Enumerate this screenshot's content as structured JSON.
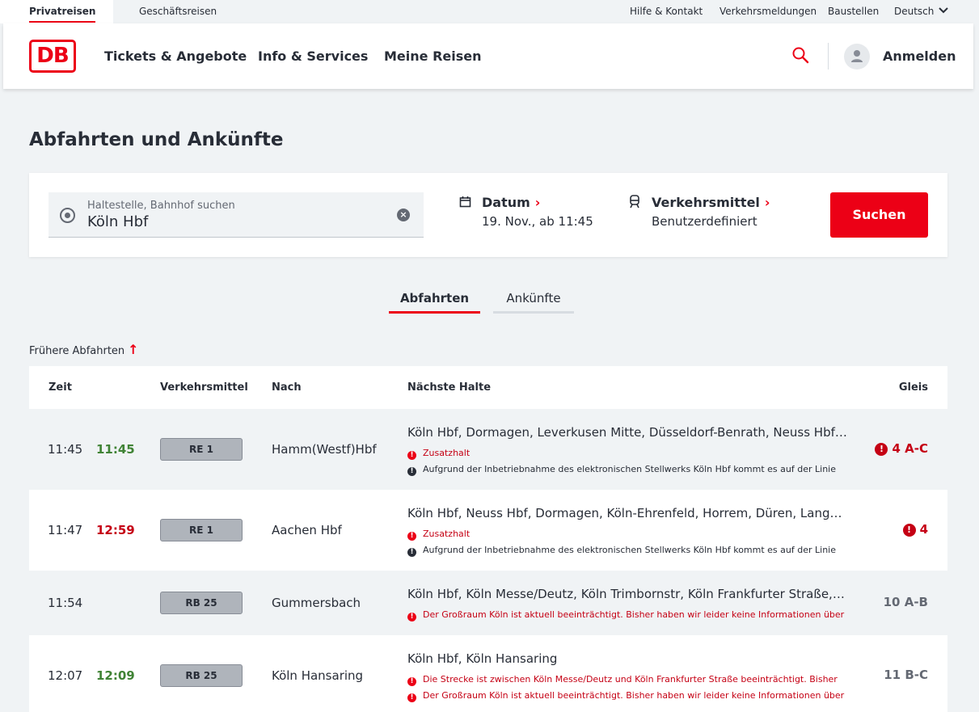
{
  "topbar": {
    "tab_private": "Privatreisen",
    "tab_business": "Geschäftsreisen",
    "help": "Hilfe & Kontakt",
    "traffic": "Verkehrsmeldungen",
    "construction": "Baustellen",
    "language": "Deutsch"
  },
  "header": {
    "logo": "DB",
    "nav": [
      "Tickets & Angebote",
      "Info & Services",
      "Meine Reisen"
    ],
    "login": "Anmelden"
  },
  "page_title": "Abfahrten und Ankünfte",
  "search": {
    "stop_placeholder": "Haltestelle, Bahnhof suchen",
    "stop_value": "Köln Hbf",
    "date_label": "Datum",
    "date_value": "19. Nov., ab 11:45",
    "transport_label": "Verkehrsmittel",
    "transport_value": "Benutzerdefiniert",
    "button": "Suchen"
  },
  "tabs": {
    "departures": "Abfahrten",
    "arrivals": "Ankünfte"
  },
  "earlier": "Frühere Abfahrten",
  "table": {
    "headers": {
      "time": "Zeit",
      "transport": "Verkehrsmittel",
      "to": "Nach",
      "stops": "Nächste Halte",
      "platform": "Gleis"
    },
    "rows": [
      {
        "planned": "11:45",
        "actual": "11:45",
        "actual_status": "on-time",
        "train": "RE 1",
        "destination": "Hamm(Westf)Hbf",
        "stops": "Köln Hbf, Dormagen, Leverkusen Mitte, Düsseldorf-Benrath, Neuss Hbf, Düsseldorf Hbf",
        "msg1": "Zusatzhalt",
        "msg2": "Aufgrund der Inbetriebnahme des elektronischen Stellwerks Köln Hbf kommt es auf der Linie",
        "platform": "4 A-C",
        "platform_changed": true
      },
      {
        "planned": "11:47",
        "actual": "12:59",
        "actual_status": "delayed",
        "train": "RE 1",
        "destination": "Aachen Hbf",
        "stops": "Köln Hbf, Neuss Hbf, Dormagen, Köln-Ehrenfeld, Horrem, Düren, Langerwehe",
        "msg1": "Zusatzhalt",
        "msg2": "Aufgrund der Inbetriebnahme des elektronischen Stellwerks Köln Hbf kommt es auf der Linie",
        "platform": "4",
        "platform_changed": true
      },
      {
        "planned": "11:54",
        "actual": "",
        "actual_status": "none",
        "train": "RB 25",
        "destination": "Gummersbach",
        "stops": "Köln Hbf, Köln Messe/Deutz, Köln Trimbornstr, Köln Frankfurter Straße, Rösrath",
        "msg1": "Der Großraum Köln ist aktuell beeinträchtigt. Bisher haben wir leider keine Informationen über",
        "platform": "10 A-B",
        "platform_changed": false
      },
      {
        "planned": "12:07",
        "actual": "12:09",
        "actual_status": "on-time",
        "train": "RB 25",
        "destination": "Köln Hansaring",
        "stops": "Köln Hbf, Köln Hansaring",
        "msg1": "Die Strecke ist zwischen Köln Messe/Deutz und Köln Frankfurter Straße beeinträchtigt. Bisher",
        "msg2": "Der Großraum Köln ist aktuell beeinträchtigt. Bisher haben wir leider keine Informationen über",
        "platform": "11 B-C",
        "platform_changed": false
      }
    ]
  },
  "colors": {
    "brand": "#ec0016",
    "delay": "#c50014",
    "on_time": "#408335"
  }
}
